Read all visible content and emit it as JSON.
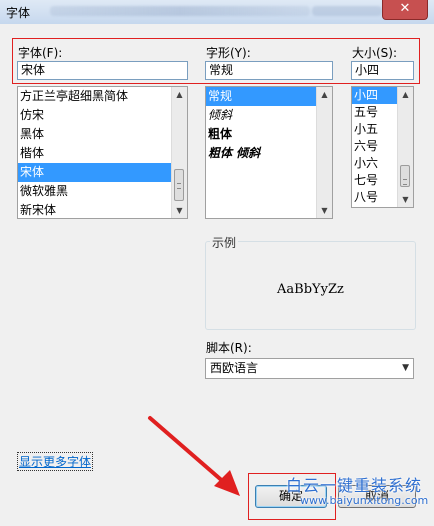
{
  "window": {
    "title": "字体",
    "close_glyph": "✕"
  },
  "font": {
    "label": "字体(F):",
    "value": "宋体",
    "items": [
      {
        "label": "方正兰亭超细黑简体",
        "selected": false
      },
      {
        "label": "仿宋",
        "selected": false
      },
      {
        "label": "黑体",
        "selected": false
      },
      {
        "label": "楷体",
        "selected": false
      },
      {
        "label": "宋体",
        "selected": true
      },
      {
        "label": "微软雅黑",
        "selected": false
      },
      {
        "label": "新宋体",
        "selected": false
      }
    ]
  },
  "style": {
    "label": "字形(Y):",
    "value": "常规",
    "items": [
      {
        "label": "常规",
        "selected": true
      },
      {
        "label": "倾斜",
        "selected": false
      },
      {
        "label": "粗体",
        "selected": false
      },
      {
        "label": "粗体 倾斜",
        "selected": false
      }
    ]
  },
  "size": {
    "label": "大小(S):",
    "value": "小四",
    "items": [
      {
        "label": "小四",
        "selected": true
      },
      {
        "label": "五号",
        "selected": false
      },
      {
        "label": "小五",
        "selected": false
      },
      {
        "label": "六号",
        "selected": false
      },
      {
        "label": "小六",
        "selected": false
      },
      {
        "label": "七号",
        "selected": false
      },
      {
        "label": "八号",
        "selected": false
      }
    ]
  },
  "sample": {
    "label": "示例",
    "text": "AaBbYyZz"
  },
  "script": {
    "label": "脚本(R):",
    "value": "西欧语言"
  },
  "more_fonts_link": "显示更多字体",
  "buttons": {
    "ok": "确定",
    "cancel": "取消"
  },
  "watermark": {
    "line1": "白云一键重装系统",
    "line2": "www.baiyunxitong.com"
  },
  "colors": {
    "selection": "#3399ff",
    "highlight_box": "#e02020",
    "link": "#0066cc"
  }
}
